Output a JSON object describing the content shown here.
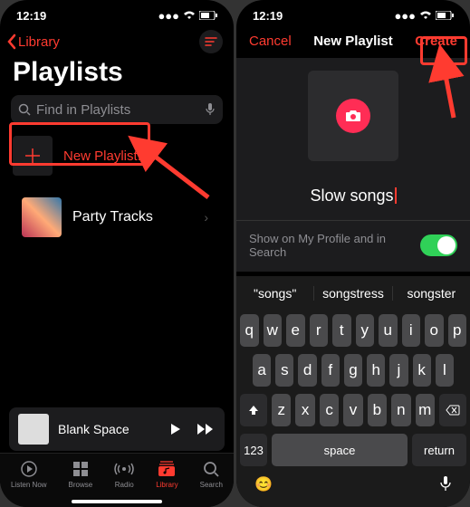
{
  "status": {
    "time": "12:19"
  },
  "left": {
    "back_label": "Library",
    "title": "Playlists",
    "search_placeholder": "Find in Playlists",
    "new_playlist_label": "New Playlist...",
    "playlists": [
      {
        "name": "Party Tracks"
      }
    ],
    "now_playing": {
      "title": "Blank Space"
    },
    "tabs": {
      "listen": "Listen Now",
      "browse": "Browse",
      "radio": "Radio",
      "library": "Library",
      "search": "Search"
    }
  },
  "right": {
    "cancel": "Cancel",
    "title": "New Playlist",
    "create": "Create",
    "name_value": "Slow songs",
    "option_label": "Show on My Profile and in Search",
    "option_on": true,
    "suggestions": [
      "\"songs\"",
      "songstress",
      "songster"
    ],
    "keys_r1": [
      "q",
      "w",
      "e",
      "r",
      "t",
      "y",
      "u",
      "i",
      "o",
      "p"
    ],
    "keys_r2": [
      "a",
      "s",
      "d",
      "f",
      "g",
      "h",
      "j",
      "k",
      "l"
    ],
    "keys_r3": [
      "z",
      "x",
      "c",
      "v",
      "b",
      "n",
      "m"
    ],
    "key_num": "123",
    "key_space": "space",
    "key_return": "return"
  }
}
